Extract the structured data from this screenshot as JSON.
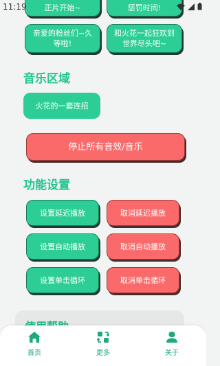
{
  "status_bar": {
    "time": "11:19"
  },
  "top_buttons": {
    "row1_left": "正片开始~",
    "row1_right": "惩罚时间!",
    "row2_left": "亲爱的粉丝们~久等啦!",
    "row2_right": "和火花一起狂欢到世界尽头吧~"
  },
  "music_section": {
    "title": "音乐区域",
    "track_button": "火花的一套连招",
    "stop_all_button": "停止所有音效/音乐"
  },
  "settings_section": {
    "title": "功能设置",
    "set_delay": "设置延迟播放",
    "cancel_delay": "取消延迟播放",
    "set_autoplay": "设置自动播放",
    "cancel_autoplay": "取消自动播放",
    "set_loop": "设置单击循环",
    "cancel_loop": "取消单击循环"
  },
  "help_section": {
    "title": "使用帮助"
  },
  "bottom_nav": {
    "home": "首页",
    "more": "更多",
    "about": "关于"
  },
  "colors": {
    "accent_green": "#2dce96",
    "danger_red": "#fb6a6a",
    "title_green": "#22c58c"
  }
}
